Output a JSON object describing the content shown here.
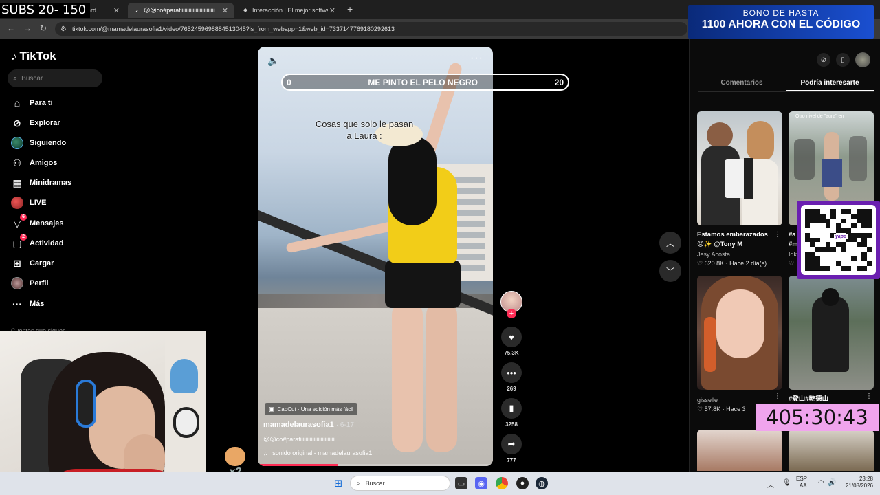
{
  "browser": {
    "tabs": [
      {
        "label": "oard",
        "active": false
      },
      {
        "label": "😕😕co#paratiiiiiiiiiiiiiiiiiiiiiiiii",
        "active": true
      },
      {
        "label": "Interacción | El mejor software",
        "active": false
      }
    ],
    "url": "tiktok.com/@mamadelaurasofia1/video/7652459698884513045?is_from_webapp=1&web_id=7337147769180292613"
  },
  "overlay": {
    "subs": "SUBS 20- 150",
    "promo_line1": "BONO DE HASTA",
    "promo_line2": "1100 AHORA CON EL CÓDIGO",
    "goal_left": "0",
    "goal_text": "ME PINTO EL PELO NEGRO",
    "goal_right": "20",
    "timer": "405:30:43",
    "qr_label": "yape",
    "hamster_label": "x2"
  },
  "sidebar": {
    "logo": "TikTok",
    "search_placeholder": "Buscar",
    "items": [
      {
        "label": "Para ti",
        "icon": "home-icon"
      },
      {
        "label": "Explorar",
        "icon": "compass-icon"
      },
      {
        "label": "Siguiendo",
        "icon": "following-avatar"
      },
      {
        "label": "Amigos",
        "icon": "friends-icon"
      },
      {
        "label": "Minidramas",
        "icon": "film-icon"
      },
      {
        "label": "LIVE",
        "icon": "live-avatar"
      },
      {
        "label": "Mensajes",
        "icon": "messages-icon",
        "badge": "6"
      },
      {
        "label": "Actividad",
        "icon": "activity-icon",
        "badge": "2"
      },
      {
        "label": "Cargar",
        "icon": "upload-icon"
      },
      {
        "label": "Perfil",
        "icon": "profile-avatar"
      },
      {
        "label": "Más",
        "icon": "more-icon"
      }
    ],
    "following_accounts_label": "Cuentas que sigues"
  },
  "video": {
    "caption_line1": "Cosas que solo le pasan",
    "caption_line2": "a Laura :",
    "capcut": "CapCut · Una edición más fácil",
    "author": "mamadelaurasofia1",
    "date": "· 6-17",
    "description": "😕😕co#paratiiiiiiiiiiiiiiiiiiiiiiiii",
    "sound": "sonido original - mamadelaurasofia1",
    "progress": 0.34
  },
  "actions": {
    "likes": "75.3K",
    "comments": "269",
    "saves": "3258",
    "shares": "777"
  },
  "right_panel": {
    "tabs": [
      {
        "label": "Comentarios",
        "active": false
      },
      {
        "label": "Podría interesarte",
        "active": true
      }
    ],
    "cards": [
      {
        "title": "Estamos embarazados",
        "title2": "😣✨ @Tony M",
        "author": "Jesy Acosta",
        "meta": "♡ 620.8K · Hace 2 día(s)"
      },
      {
        "title": "#a",
        "title2": "#m",
        "author": "Idk",
        "meta": "♡"
      },
      {
        "title": "",
        "title2": "",
        "author": "gisselle",
        "meta": "♡ 57.8K · Hace 3"
      },
      {
        "title": "#登山#乾德山",
        "title2": "",
        "author": "",
        "meta": ""
      }
    ],
    "thumb_overlay_text": "Otro nivel de \"aura\" en"
  },
  "taskbar": {
    "search_placeholder": "Buscar",
    "lang_line1": "ESP",
    "lang_line2": "LAA",
    "time": "23:28",
    "date": "21/08/2026"
  },
  "colors": {
    "accent": "#fe2c55",
    "goal_border": "#ffffff",
    "timer_bg": "#f0a4ed",
    "qr_frame": "#6a1fb0"
  }
}
